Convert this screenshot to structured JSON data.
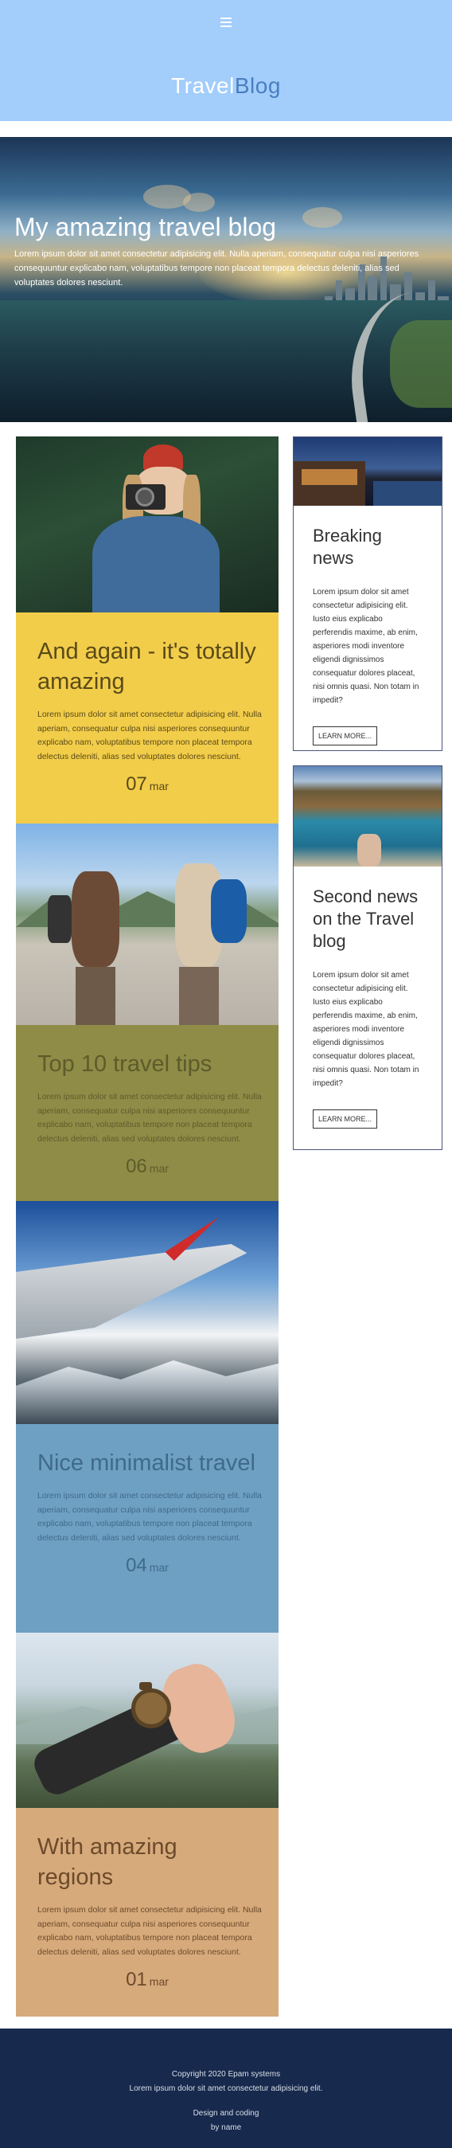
{
  "header": {
    "menu_icon": "hamburger-icon",
    "logo_part1": "Travel",
    "logo_part2": "Blog",
    "background": "#a3cdfb"
  },
  "hero": {
    "title": "My amazing travel blog",
    "text": "Lorem ipsum dolor sit amet consectetur adipisicing elit. Nulla aperiam, consequatur culpa nisi asperiores consequuntur explicabo nam, voluptatibus tempore non placeat tempora delectus deleniti, alias sed voluptates dolores nesciunt."
  },
  "posts": [
    {
      "title": "And again - it's totally amazing",
      "text": "Lorem ipsum dolor sit amet consectetur adipisicing elit. Nulla aperiam, consequatur culpa nisi asperiores consequuntur explicabo nam, voluptatibus tempore non placeat tempora delectus deleniti, alias sed voluptates dolores nesciunt.",
      "day": "07",
      "month": "mar",
      "bg": "#f2cd4a"
    },
    {
      "title": "Top 10 travel tips",
      "text": "Lorem ipsum dolor sit amet consectetur adipisicing elit. Nulla aperiam, consequatur culpa nisi asperiores consequuntur explicabo nam, voluptatibus tempore non placeat tempora delectus deleniti, alias sed voluptates dolores nesciunt.",
      "day": "06",
      "month": "mar",
      "bg": "#8f8c47"
    },
    {
      "title": "Nice minimalist travel",
      "text": "Lorem ipsum dolor sit amet consectetur adipisicing elit. Nulla aperiam, consequatur culpa nisi asperiores consequuntur explicabo nam, voluptatibus tempore non placeat tempora delectus deleniti, alias sed voluptates dolores nesciunt.",
      "day": "04",
      "month": "mar",
      "bg": "#6ea0c4"
    },
    {
      "title": "With amazing regions",
      "text": "Lorem ipsum dolor sit amet consectetur adipisicing elit. Nulla aperiam, consequatur culpa nisi asperiores consequuntur explicabo nam, voluptatibus tempore non placeat tempora delectus deleniti, alias sed voluptates dolores nesciunt.",
      "day": "01",
      "month": "mar",
      "bg": "#d7aa7b"
    }
  ],
  "sidebar": [
    {
      "title": "Breaking news",
      "text": "Lorem ipsum dolor sit amet consectetur adipisicing elit. Iusto eius explicabo perferendis maxime, ab enim, asperiores modi inventore eligendi dignissimos consequatur dolores placeat, nisi omnis quasi. Non totam in impedit?",
      "button": "LEARN MORE..."
    },
    {
      "title": "Second news on the Travel blog",
      "text": "Lorem ipsum dolor sit amet consectetur adipisicing elit. Iusto eius explicabo perferendis maxime, ab enim, asperiores modi inventore eligendi dignissimos consequatur dolores placeat, nisi omnis quasi. Non totam in impedit?",
      "button": "LEARN MORE..."
    }
  ],
  "footer": {
    "copyright": "Copyright 2020 Epam systems",
    "tagline": "Lorem ipsum dolor sit amet consectetur adipisicing elit.",
    "credits_line1": "Design and coding",
    "credits_line2": "by name",
    "background": "#17294d"
  }
}
